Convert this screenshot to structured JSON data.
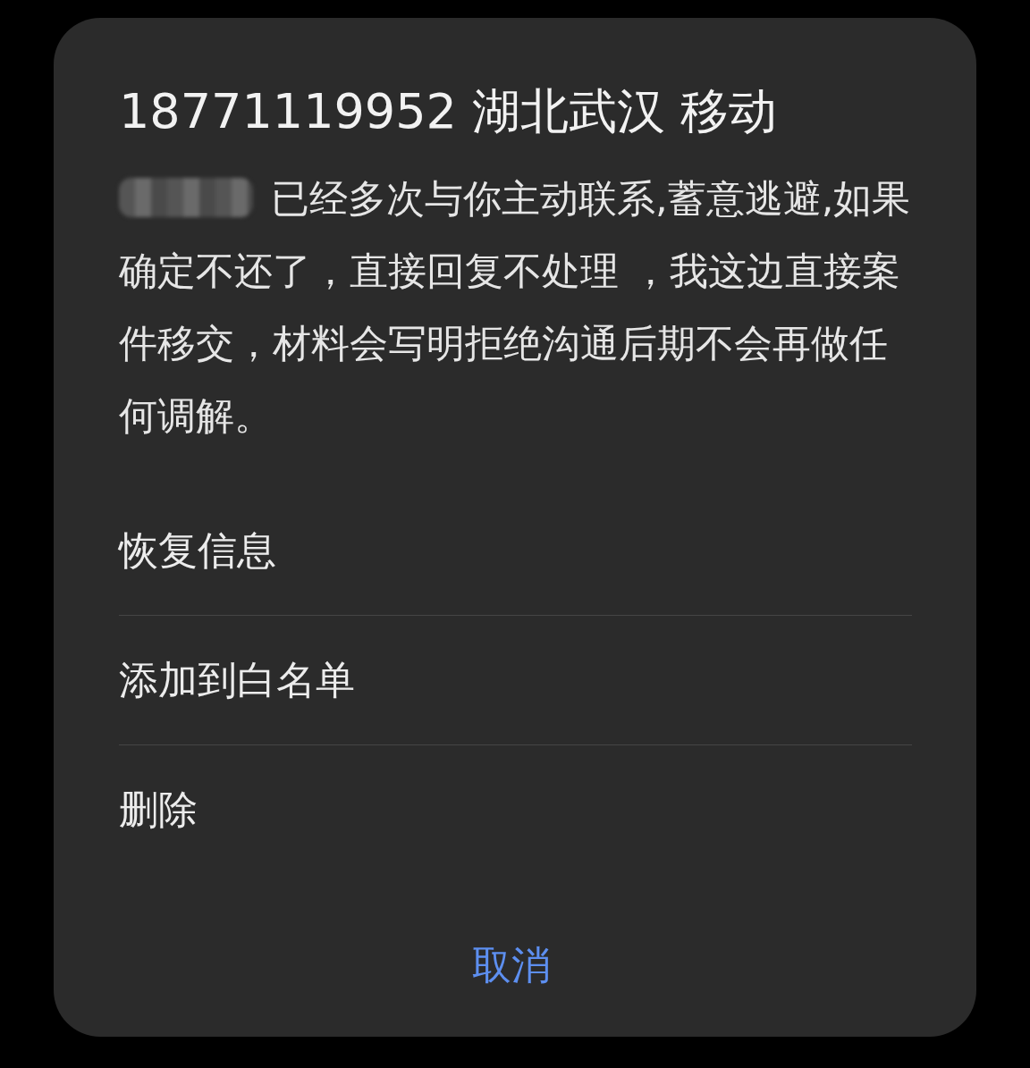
{
  "dialog": {
    "title": "18771119952 湖北武汉 移动",
    "message": "已经多次与你主动联系,蓄意逃避,如果确定不还了，直接回复不处理 ，我这边直接案件移交，材料会写明拒绝沟通后期不会再做任何调解。",
    "actions": [
      {
        "label": "恢复信息"
      },
      {
        "label": "添加到白名单"
      },
      {
        "label": "删除"
      }
    ],
    "cancel": "取消"
  }
}
